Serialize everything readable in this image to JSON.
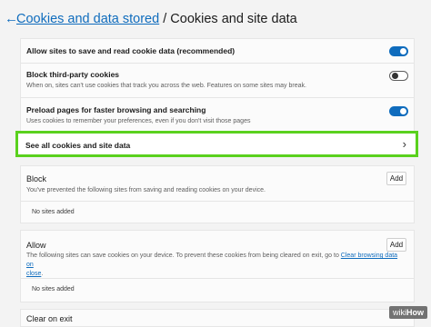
{
  "header": {
    "back_glyph": "←",
    "parent": "Cookies and data stored",
    "separator": " / ",
    "current": "Cookies and site data"
  },
  "settings": [
    {
      "title": "Allow sites to save and read cookie data (recommended)",
      "desc": "",
      "toggle": "on"
    },
    {
      "title": "Block third-party cookies",
      "desc": "When on, sites can't use cookies that track you across the web. Features on some sites may break.",
      "toggle": "off"
    },
    {
      "title": "Preload pages for faster browsing and searching",
      "desc": "Uses cookies to remember your preferences, even if you don't visit those pages",
      "toggle": "on"
    }
  ],
  "see_all": {
    "label": "See all cookies and site data",
    "chevron": "›"
  },
  "block": {
    "title": "Block",
    "desc": "You've prevented the following sites from saving and reading cookies on your device.",
    "add_label": "Add",
    "empty": "No sites added"
  },
  "allow": {
    "title": "Allow",
    "desc_before": "The following sites can save cookies on your device. To prevent these cookies from being cleared on exit, go to ",
    "desc_link": "Clear browsing data on",
    "desc_link2": "close",
    "desc_after": ".",
    "add_label": "Add",
    "empty": "No sites added"
  },
  "clear_on_exit": {
    "title": "Clear on exit"
  },
  "watermark": {
    "prefix": "wiki",
    "suffix": "How"
  },
  "colors": {
    "accent": "#0f6cbd",
    "highlight": "#5ad11e"
  }
}
